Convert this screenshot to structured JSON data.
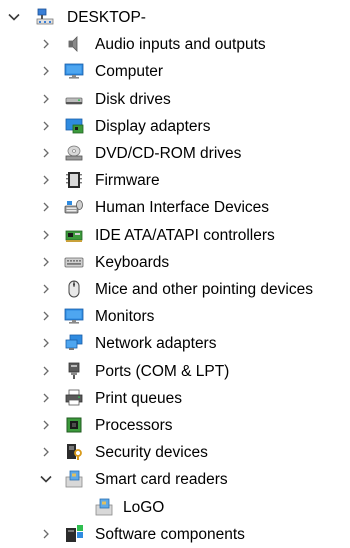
{
  "root": {
    "label": "DESKTOP-",
    "expanded": true,
    "icon": "computer-tree-icon"
  },
  "items": [
    {
      "label": "Audio inputs and outputs",
      "icon": "speaker-icon",
      "expanded": false
    },
    {
      "label": "Computer",
      "icon": "monitor-icon",
      "expanded": false
    },
    {
      "label": "Disk drives",
      "icon": "disk-drive-icon",
      "expanded": false
    },
    {
      "label": "Display adapters",
      "icon": "display-adapter-icon",
      "expanded": false
    },
    {
      "label": "DVD/CD-ROM drives",
      "icon": "dvd-drive-icon",
      "expanded": false
    },
    {
      "label": "Firmware",
      "icon": "firmware-chip-icon",
      "expanded": false
    },
    {
      "label": "Human Interface Devices",
      "icon": "hid-icon",
      "expanded": false
    },
    {
      "label": "IDE ATA/ATAPI controllers",
      "icon": "ide-controller-icon",
      "expanded": false
    },
    {
      "label": "Keyboards",
      "icon": "keyboard-icon",
      "expanded": false
    },
    {
      "label": "Mice and other pointing devices",
      "icon": "mouse-icon",
      "expanded": false
    },
    {
      "label": "Monitors",
      "icon": "monitor-icon",
      "expanded": false
    },
    {
      "label": "Network adapters",
      "icon": "network-adapter-icon",
      "expanded": false
    },
    {
      "label": "Ports (COM & LPT)",
      "icon": "port-icon",
      "expanded": false
    },
    {
      "label": "Print queues",
      "icon": "printer-icon",
      "expanded": false
    },
    {
      "label": "Processors",
      "icon": "processor-icon",
      "expanded": false
    },
    {
      "label": "Security devices",
      "icon": "security-key-icon",
      "expanded": false
    },
    {
      "label": "Smart card readers",
      "icon": "smart-card-reader-icon",
      "expanded": true,
      "children": [
        {
          "label": "LoGO",
          "icon": "smart-card-reader-icon"
        }
      ]
    },
    {
      "label": "Software components",
      "icon": "software-components-icon",
      "expanded": false
    }
  ],
  "colors": {
    "chevron": "#6b6b6b",
    "text": "#000000",
    "background": "#ffffff",
    "accent": "#1e88d8"
  }
}
